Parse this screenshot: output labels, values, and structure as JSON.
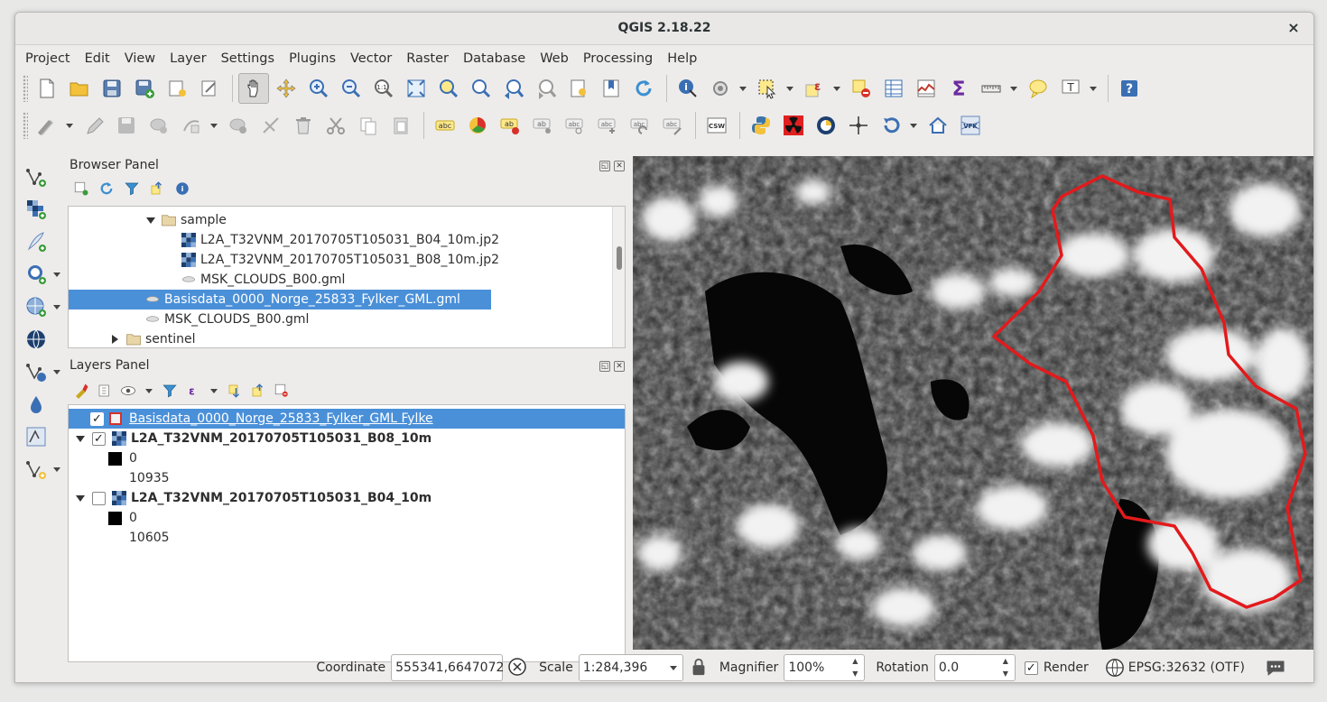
{
  "window": {
    "title": "QGIS 2.18.22",
    "close_label": "×"
  },
  "menu": [
    "Project",
    "Edit",
    "View",
    "Layer",
    "Settings",
    "Plugins",
    "Vector",
    "Raster",
    "Database",
    "Web",
    "Processing",
    "Help"
  ],
  "browser_panel": {
    "title": "Browser Panel",
    "items": [
      {
        "label": "sample",
        "type": "folder",
        "expanded": true
      },
      {
        "label": "L2A_T32VNM_20170705T105031_B04_10m.jp2",
        "type": "raster"
      },
      {
        "label": "L2A_T32VNM_20170705T105031_B08_10m.jp2",
        "type": "raster"
      },
      {
        "label": "MSK_CLOUDS_B00.gml",
        "type": "vector"
      },
      {
        "label": "Basisdata_0000_Norge_25833_Fylker_GML.gml",
        "type": "vector",
        "selected": true
      },
      {
        "label": "MSK_CLOUDS_B00.gml",
        "type": "vector"
      },
      {
        "label": "sentinel",
        "type": "folder",
        "expanded": false
      }
    ]
  },
  "layers_panel": {
    "title": "Layers Panel",
    "layers": [
      {
        "label": "Basisdata_0000_Norge_25833_Fylker_GML Fylke",
        "checked": true,
        "selected": true
      },
      {
        "label": "L2A_T32VNM_20170705T105031_B08_10m",
        "checked": true,
        "legend_min": "0",
        "legend_max": "10935"
      },
      {
        "label": "L2A_T32VNM_20170705T105031_B04_10m",
        "checked": false,
        "legend_min": "0",
        "legend_max": "10605"
      }
    ]
  },
  "status": {
    "coordinate_label": "Coordinate",
    "coordinate_value": "555341,6647072",
    "scale_label": "Scale",
    "scale_value": "1:284,396",
    "magnifier_label": "Magnifier",
    "magnifier_value": "100%",
    "rotation_label": "Rotation",
    "rotation_value": "0.0",
    "render_label": "Render",
    "render_checked": true,
    "crs": "EPSG:32632 (OTF)"
  },
  "toolbar_icons": {
    "row1": [
      "new-project-icon",
      "open-project-icon",
      "save-project-icon",
      "save-as-icon",
      "new-print-composer-icon",
      "composer-manager-icon",
      "pan-icon",
      "pan-to-selection-icon",
      "zoom-in-icon",
      "zoom-out-icon",
      "zoom-native-icon",
      "zoom-full-icon",
      "zoom-to-selection-icon",
      "zoom-to-layer-icon",
      "zoom-last-icon",
      "zoom-next-icon",
      "new-bookmark-icon",
      "show-bookmarks-icon",
      "refresh-icon",
      "identify-icon",
      "run-feature-action-icon",
      "select-feature-icon",
      "select-by-expression-icon",
      "deselect-icon",
      "attribute-table-icon",
      "field-calculator-icon",
      "statistics-icon",
      "measure-icon",
      "map-tips-icon",
      "text-annotation-icon",
      "help-icon"
    ],
    "row2": [
      "current-edits-icon",
      "toggle-editing-icon",
      "save-layer-edits-icon",
      "add-feature-icon",
      "move-feature-icon",
      "node-tool-icon",
      "delete-selected-icon",
      "cut-features-icon",
      "copy-features-icon",
      "paste-features-icon",
      "label-icon",
      "diagram-icon",
      "pin-label-icon",
      "show-hide-labels-icon",
      "move-label-icon",
      "rotate-label-icon",
      "change-label-icon",
      "csw-icon",
      "python-icon",
      "radiation-icon",
      "plugin-icon",
      "crosshair-icon",
      "undo-icon",
      "home-icon",
      "vfk-icon"
    ],
    "left": [
      "add-vector-layer-icon",
      "add-raster-layer-icon",
      "add-delimited-text-icon",
      "add-postgis-layer-icon",
      "add-spatialite-layer-icon",
      "add-wms-layer-icon",
      "add-wfs-layer-icon",
      "add-virtual-layer-icon",
      "new-shapefile-icon"
    ]
  },
  "colors": {
    "selection": "#4a90d9",
    "boundary": "#e31a1c"
  }
}
